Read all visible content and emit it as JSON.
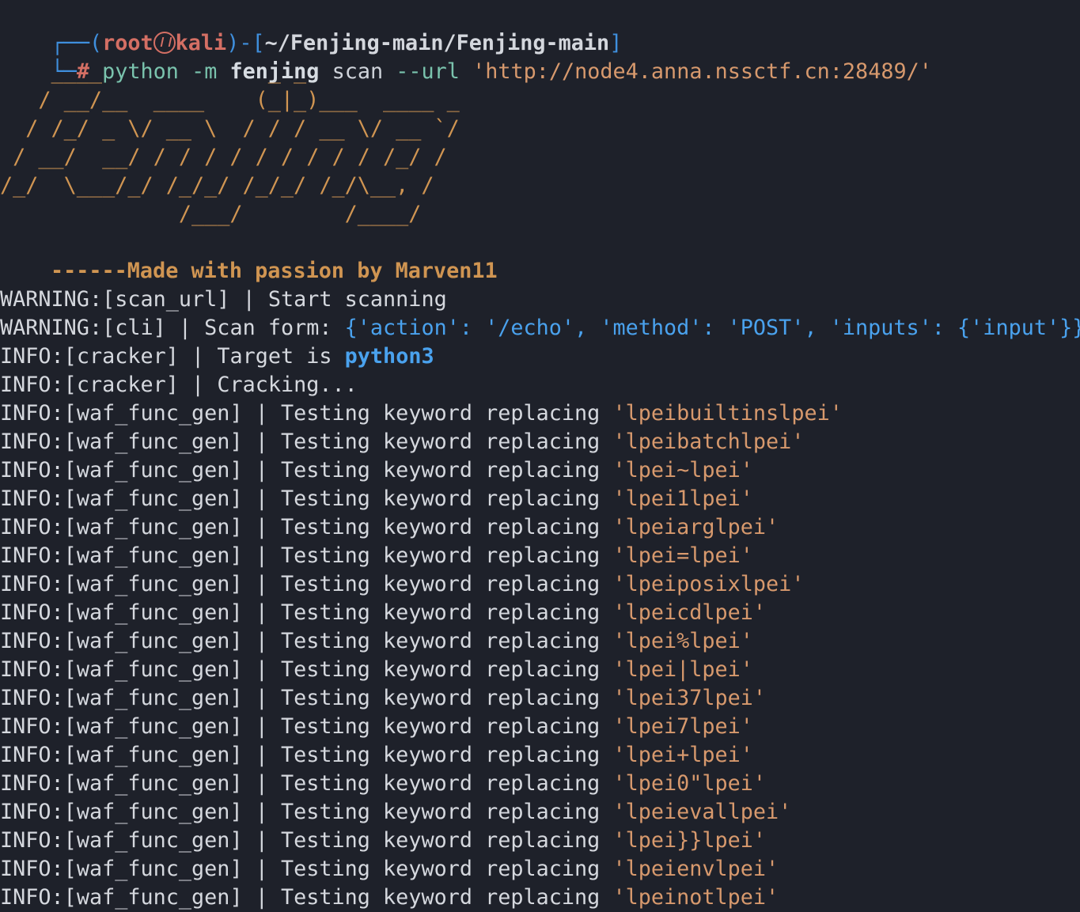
{
  "colors": {
    "background": "#1e212a",
    "text": "#d5d8de",
    "prompt_blue": "#3f8fdd",
    "prompt_red": "#d46f64",
    "command_green": "#7ac3ad",
    "string_orange": "#d7996d",
    "ascii_orange": "#d09552",
    "info_blue": "#4aa2ee"
  },
  "prompt": {
    "top_left": "┌──(",
    "user": "root",
    "at_icon": "skull-icon",
    "host": "kali",
    "close_paren_dash_bracket": ")-[",
    "path": "~/Fenjing-main/Fenjing-main",
    "close_bracket": "]",
    "bottom_left": "└─",
    "hash": "#",
    "command": "python",
    "arg1": "-m",
    "module": "fenjing",
    "subcommand": "scan",
    "flag": "--url",
    "url": "'http://node4.anna.nssctf.cn:28489/'"
  },
  "banner": {
    "ascii": [
      "    ____             _ _",
      "   / __/__  ____    (_|_)___  ____ _",
      "  / /_/ _ \\/ __ \\  / / / __ \\/ __ `/",
      " / __/  __/ / / / / / / / / / /_/ /",
      "/_/  \\___/_/ /_/_/ /_/_/ /_/\\__, /",
      "              /___/        /____/"
    ],
    "credit": "------Made with passion by Marven11"
  },
  "logs": [
    {
      "level": "WARNING",
      "source": "scan_url",
      "message": "Start scanning"
    },
    {
      "level": "WARNING",
      "source": "cli",
      "message": "Scan form:",
      "value": "{'action': '/echo', 'method': 'POST', 'inputs': {'input'}}"
    },
    {
      "level": "INFO",
      "source": "cracker",
      "message": "Target is",
      "value": "python3"
    },
    {
      "level": "INFO",
      "source": "cracker",
      "message": "Cracking..."
    },
    {
      "level": "INFO",
      "source": "waf_func_gen",
      "message": "Testing keyword replacing",
      "value": "'lpeibuiltinslpei'"
    },
    {
      "level": "INFO",
      "source": "waf_func_gen",
      "message": "Testing keyword replacing",
      "value": "'lpeibatchlpei'"
    },
    {
      "level": "INFO",
      "source": "waf_func_gen",
      "message": "Testing keyword replacing",
      "value": "'lpei~lpei'"
    },
    {
      "level": "INFO",
      "source": "waf_func_gen",
      "message": "Testing keyword replacing",
      "value": "'lpei1lpei'"
    },
    {
      "level": "INFO",
      "source": "waf_func_gen",
      "message": "Testing keyword replacing",
      "value": "'lpeiarglpei'"
    },
    {
      "level": "INFO",
      "source": "waf_func_gen",
      "message": "Testing keyword replacing",
      "value": "'lpei=lpei'"
    },
    {
      "level": "INFO",
      "source": "waf_func_gen",
      "message": "Testing keyword replacing",
      "value": "'lpeiposixlpei'"
    },
    {
      "level": "INFO",
      "source": "waf_func_gen",
      "message": "Testing keyword replacing",
      "value": "'lpeicdlpei'"
    },
    {
      "level": "INFO",
      "source": "waf_func_gen",
      "message": "Testing keyword replacing",
      "value": "'lpei%lpei'"
    },
    {
      "level": "INFO",
      "source": "waf_func_gen",
      "message": "Testing keyword replacing",
      "value": "'lpei|lpei'"
    },
    {
      "level": "INFO",
      "source": "waf_func_gen",
      "message": "Testing keyword replacing",
      "value": "'lpei37lpei'"
    },
    {
      "level": "INFO",
      "source": "waf_func_gen",
      "message": "Testing keyword replacing",
      "value": "'lpei7lpei'"
    },
    {
      "level": "INFO",
      "source": "waf_func_gen",
      "message": "Testing keyword replacing",
      "value": "'lpei+lpei'"
    },
    {
      "level": "INFO",
      "source": "waf_func_gen",
      "message": "Testing keyword replacing",
      "value": "'lpei0\"lpei'"
    },
    {
      "level": "INFO",
      "source": "waf_func_gen",
      "message": "Testing keyword replacing",
      "value": "'lpeievallpei'"
    },
    {
      "level": "INFO",
      "source": "waf_func_gen",
      "message": "Testing keyword replacing",
      "value": "'lpei}}lpei'"
    },
    {
      "level": "INFO",
      "source": "waf_func_gen",
      "message": "Testing keyword replacing",
      "value": "'lpeienvlpei'"
    },
    {
      "level": "INFO",
      "source": "waf_func_gen",
      "message": "Testing keyword replacing",
      "value": "'lpeinotlpei'"
    }
  ]
}
